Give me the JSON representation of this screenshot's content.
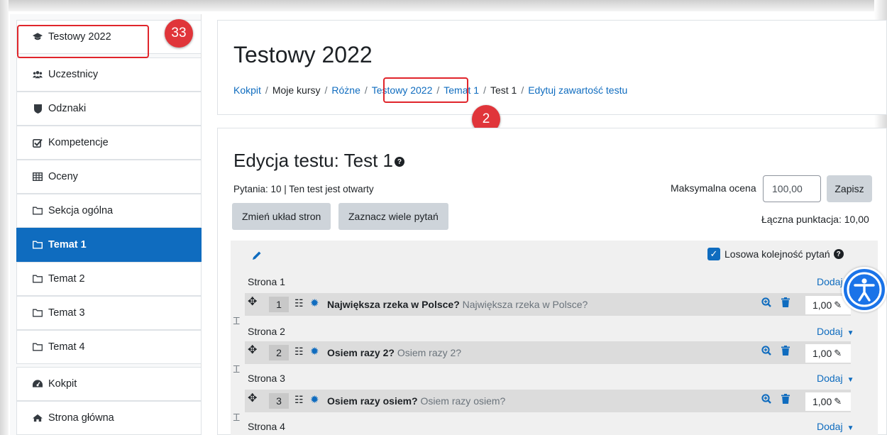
{
  "sidebar": {
    "items": [
      {
        "label": "Testowy 2022",
        "icon": "graduation-cap-icon"
      },
      {
        "label": "Uczestnicy",
        "icon": "users-icon"
      },
      {
        "label": "Odznaki",
        "icon": "shield-icon"
      },
      {
        "label": "Kompetencje",
        "icon": "check-square-icon"
      },
      {
        "label": "Oceny",
        "icon": "table-icon"
      },
      {
        "label": "Sekcja ogólna",
        "icon": "folder-icon"
      },
      {
        "label": "Temat 1",
        "icon": "folder-icon"
      },
      {
        "label": "Temat 2",
        "icon": "folder-icon"
      },
      {
        "label": "Temat 3",
        "icon": "folder-icon"
      },
      {
        "label": "Temat 4",
        "icon": "folder-icon"
      },
      {
        "label": "Kokpit",
        "icon": "dashboard-icon"
      },
      {
        "label": "Strona główna",
        "icon": "home-icon"
      }
    ]
  },
  "annotations": {
    "badge1": "33",
    "badge2": "2",
    "color": "#e0252b"
  },
  "header": {
    "title": "Testowy 2022",
    "breadcrumb": [
      "Kokpit",
      "Moje kursy",
      "Różne",
      "Testowy 2022",
      "Temat 1",
      "Test 1",
      "Edytuj zawartość testu"
    ]
  },
  "quiz": {
    "title": "Edycja testu: Test 1",
    "info": "Pytania: 10 | Ten test jest otwarty",
    "max_grade_label": "Maksymalna ocena",
    "max_grade_value": "100,00",
    "save_label": "Zapisz",
    "repaginate_label": "Zmień układ stron",
    "select_multiple_label": "Zaznacz wiele pytań",
    "total_points": "Łączna punktacja: 10,00",
    "shuffle_label": "Losowa kolejność pytań",
    "add_label": "Dodaj",
    "pages": [
      {
        "label": "Strona 1",
        "question": {
          "num": "1",
          "name": "Największa rzeka w Polsce?",
          "text": "Największa rzeka w Polsce?",
          "mark": "1,00"
        }
      },
      {
        "label": "Strona 2",
        "question": {
          "num": "2",
          "name": "Osiem razy 2?",
          "text": "Osiem razy 2?",
          "mark": "1,00"
        }
      },
      {
        "label": "Strona 3",
        "question": {
          "num": "3",
          "name": "Osiem razy osiem?",
          "text": "Osiem razy osiem?",
          "mark": "1,00"
        }
      },
      {
        "label": "Strona 4"
      }
    ]
  },
  "colors": {
    "accent": "#0f6cbf",
    "active_nav": "#0f6cbf",
    "accessibility": "#1a73e8"
  }
}
